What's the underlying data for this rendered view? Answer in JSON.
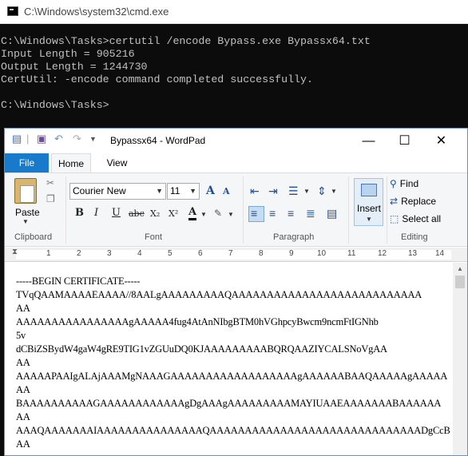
{
  "cmd": {
    "title": "C:\\Windows\\system32\\cmd.exe",
    "lines": [
      "C:\\Windows\\Tasks>certutil /encode Bypass.exe Bypassx64.txt",
      "Input Length = 905216",
      "Output Length = 1244730",
      "CertUtil: -encode command completed successfully.",
      "",
      "C:\\Windows\\Tasks>"
    ]
  },
  "wordpad": {
    "title": "Bypassx64 - WordPad",
    "window_buttons": {
      "minimize": "—",
      "maximize": "☐",
      "close": "✕"
    },
    "tabs": {
      "file": "File",
      "home": "Home",
      "view": "View"
    },
    "clipboard": {
      "paste": "Paste",
      "group": "Clipboard"
    },
    "font": {
      "family": "Courier New",
      "size": "11",
      "group": "Font",
      "grow": "A",
      "shrink": "A",
      "bold": "B",
      "italic": "I",
      "underline": "U",
      "strike": "abc",
      "subscript": "X₂",
      "superscript": "X²",
      "color": "A"
    },
    "paragraph": {
      "group": "Paragraph"
    },
    "insert": {
      "label": "Insert"
    },
    "editing": {
      "find": "Find",
      "replace": "Replace",
      "select_all": "Select all",
      "group": "Editing"
    },
    "ruler": [
      "1",
      "2",
      "3",
      "4",
      "5",
      "6",
      "7",
      "8",
      "9",
      "10",
      "11",
      "12",
      "13",
      "14"
    ],
    "document_lines": [
      "-----BEGIN CERTIFICATE-----",
      "TVqQAAMAAAAEAAAA//8AALgAAAAAAAAAQAAAAAAAAAAAAAAAAAAAAAAAAAAA",
      "AA",
      "AAAAAAAAAAAAAAAAgAAAAA4fug4AtAnNIbgBTM0hVGhpcyBwcm9ncmFtIGNhb",
      "5v",
      "dCBiZSBydW4gaW4gRE9TIG1vZGUuDQ0KJAAAAAAAAABQRQAAZIYCALSNoVgAA",
      "AA",
      "AAAAAPAAIgALAjAAAMgNAAAGAAAAAAAAAAAAAAAAAAgAAAAAABAAQAAAAAgAAAAA",
      "AA",
      "BAAAAAAAAAAGAAAAAAAAAAAAgDgAAAgAAAAAAAAAMAYIUAAEAAAAAAABAAAAAA",
      "AA",
      "AAAQAAAAAAAIAAAAAAAAAAAAAAAQAAAAAAAAAAAAAAAAAAAAAAAAAAAAAADgCcB",
      "AA"
    ]
  }
}
